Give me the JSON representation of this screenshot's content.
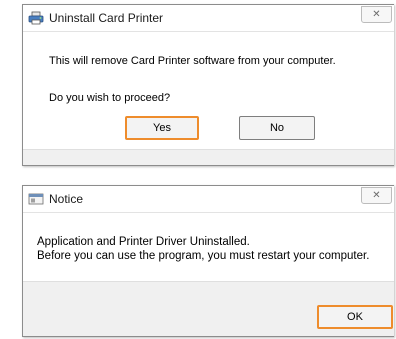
{
  "uninstall_dialog": {
    "title": "Uninstall Card Printer",
    "message": "This will remove Card Printer software from your computer.",
    "question": "Do you wish to proceed?",
    "yes_label": "Yes",
    "no_label": "No",
    "close_glyph": "✕",
    "title_icon": "printer-icon"
  },
  "notice_dialog": {
    "title": "Notice",
    "message_line1": "Application and Printer Driver Uninstalled.",
    "message_line2": "Before you can use the program, you must restart your computer.",
    "ok_label": "OK",
    "close_glyph": "✕",
    "title_icon": "window-icon"
  },
  "colors": {
    "focus_border": "#ee8c2c",
    "dialog_face": "#f0f0f0"
  }
}
